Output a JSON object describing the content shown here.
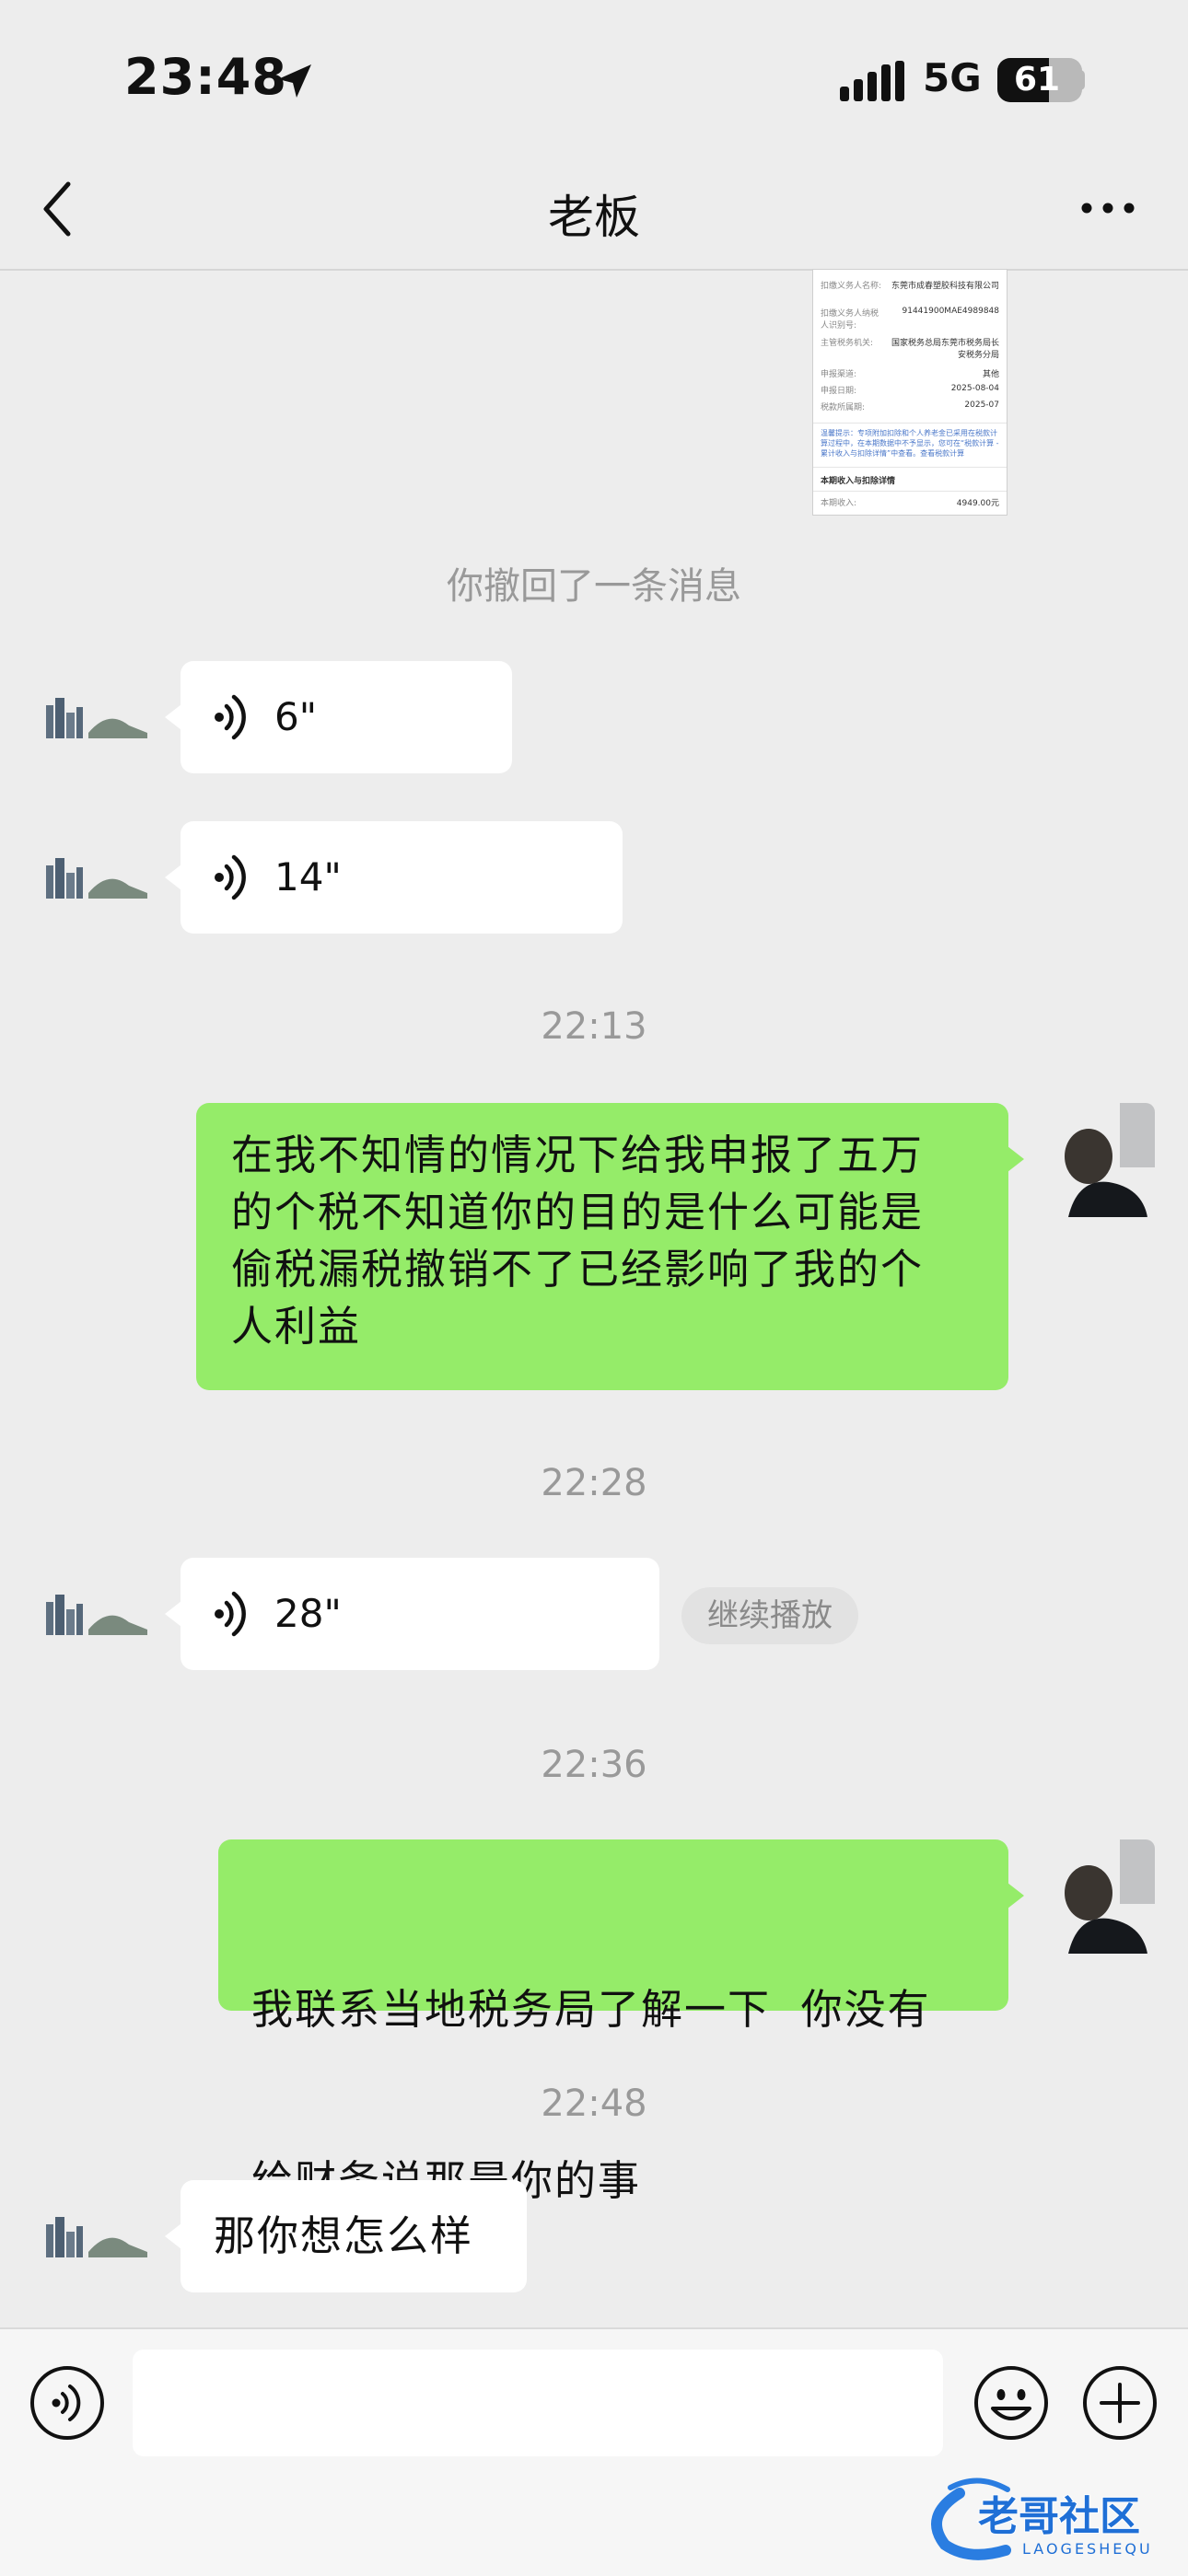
{
  "status_bar": {
    "time": "23:48",
    "network": "5G",
    "battery_level": 61,
    "battery_text": "61"
  },
  "nav": {
    "title": "老板"
  },
  "doc_thumbnail": {
    "rows": [
      {
        "label": "扣缴义务人名称:",
        "value": "东莞市成春塑胶科技有限公司"
      },
      {
        "label": "扣缴义务人纳税人识别号:",
        "value": "91441900MAE4989848"
      },
      {
        "label": "主管税务机关:",
        "value": "国家税务总局东莞市税务局长安税务分局"
      },
      {
        "label": "申报渠道:",
        "value": "其他"
      },
      {
        "label": "申报日期:",
        "value": "2025-08-04"
      },
      {
        "label": "税款所属期:",
        "value": "2025-07"
      }
    ],
    "notice": "温馨提示：专项附加扣除和个人养老金已采用在税款计算过程中，在本期数据中不予显示，您可在“税款计算 - 累计收入与扣除详情”中查看。查看税款计算",
    "section_title": "本期收入与扣除详情",
    "income_label": "本期收入:",
    "income_value": "4949.00元"
  },
  "messages": {
    "recall_notice": "你撤回了一条消息",
    "voice1": "6\"",
    "voice2": "14\"",
    "ts1": "22:13",
    "text1": [
      "在我不知情的情况下给我申报了五万",
      "的个税不知道你的目的是什么可能是",
      "偷税漏税撤销不了已经影响了我的个",
      "人利益"
    ],
    "ts2": "22:28",
    "voice3": "28\"",
    "continue_play": "继续播放",
    "ts3": "22:36",
    "text2": [
      "我联系当地税务局了解一下  你没有",
      "给财务说那是你的事"
    ],
    "ts4": "22:48",
    "text3": "那你想怎么样"
  },
  "input": {
    "placeholder": "",
    "value": ""
  },
  "watermark": {
    "text": "老哥社区",
    "sub": "LAOGESHEQU"
  },
  "colors": {
    "background": "#ededed",
    "sent_bubble": "#95ec69",
    "received_bubble": "#ffffff",
    "timestamp": "#999999"
  }
}
